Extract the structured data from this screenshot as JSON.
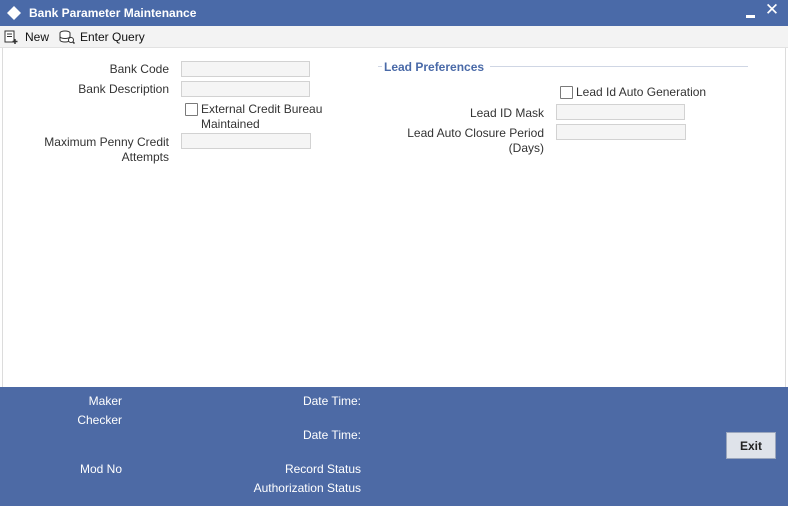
{
  "window": {
    "title": "Bank Parameter Maintenance",
    "logo_icon": "diamond-icon",
    "minimize_icon": "minimize-icon",
    "close_icon": "close-icon",
    "close_glyph": "✕"
  },
  "toolbar": {
    "new_label": "New",
    "new_icon": "new-record-icon",
    "enter_query_label": "Enter Query",
    "enter_query_icon": "query-icon"
  },
  "form": {
    "bank_code": {
      "label": "Bank Code",
      "value": ""
    },
    "bank_description": {
      "label": "Bank Description",
      "value": ""
    },
    "external_credit_bureau": {
      "label_line1": "External Credit Bureau",
      "label_line2": "Maintained",
      "checked": false
    },
    "max_penny_credit": {
      "label_line1": "Maximum Penny Credit",
      "label_line2": "Attempts",
      "value": ""
    }
  },
  "lead_preferences": {
    "title": "Lead Preferences",
    "lead_id_auto_generation": {
      "label": "Lead Id Auto Generation",
      "checked": false
    },
    "lead_id_mask": {
      "label": "Lead ID Mask",
      "value": ""
    },
    "lead_auto_closure": {
      "label_line1": "Lead Auto Closure Period",
      "label_line2": "(Days)",
      "value": ""
    }
  },
  "footer": {
    "maker": "Maker",
    "checker": "Checker",
    "mod_no": "Mod No",
    "date_time_1": "Date Time:",
    "date_time_2": "Date Time:",
    "record_status": "Record Status",
    "authorization_status": "Authorization Status",
    "exit_label": "Exit"
  },
  "colors": {
    "title_bar": "#4a6aa8",
    "footer": "#4d6aa5",
    "section_title": "#4a6aa8"
  }
}
